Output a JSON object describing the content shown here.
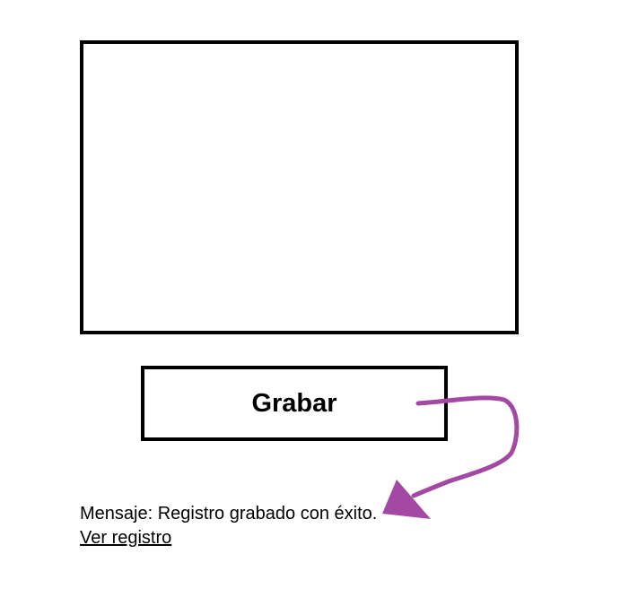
{
  "form": {
    "submit_label": "Grabar"
  },
  "status": {
    "message": "Mensaje: Registro grabado con éxito.",
    "link_label": "Ver registro"
  },
  "annotation": {
    "icon": "curved-arrow-icon",
    "color": "#a349a4"
  }
}
